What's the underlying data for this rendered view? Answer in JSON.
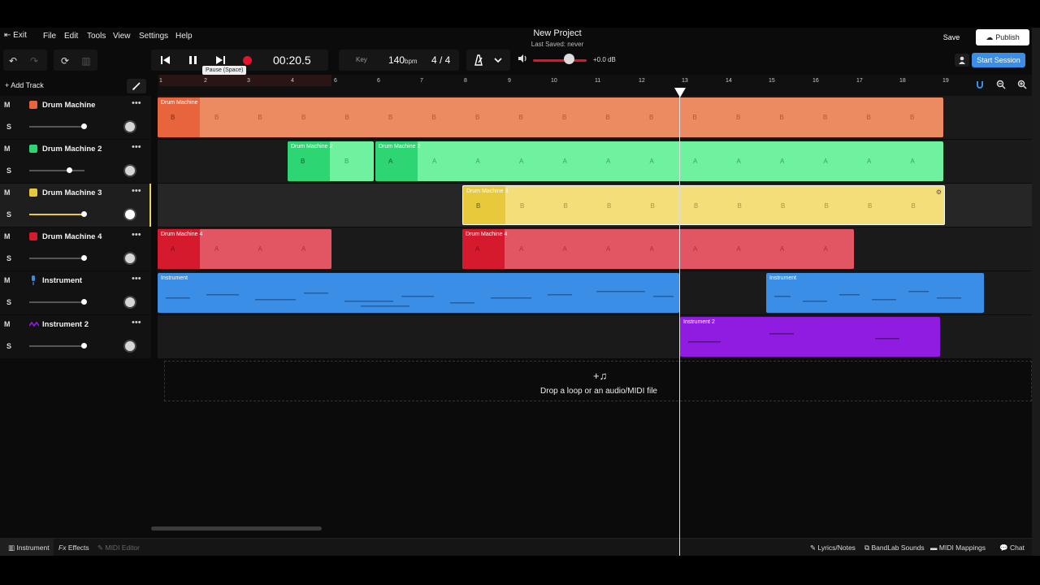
{
  "menu": {
    "exit": "Exit",
    "items": [
      "File",
      "Edit",
      "Tools",
      "View",
      "Settings",
      "Help"
    ]
  },
  "project": {
    "title": "New Project",
    "last_saved": "Last Saved: never"
  },
  "actions": {
    "save": "Save",
    "publish": "Publish",
    "start_session": "Start Session"
  },
  "transport": {
    "time": "00:20.5",
    "tooltip": "Pause (Space)",
    "bpm": "140",
    "bpm_unit": "bpm",
    "key_label": "Key",
    "time_signature": "4 / 4",
    "volume_db": "+0.0 dB",
    "volume_level": 0.66
  },
  "tracks_panel": {
    "add_track": "Add Track"
  },
  "ruler": {
    "marks": [
      "1",
      "2",
      "3",
      "4",
      "6",
      "6",
      "7",
      "8",
      "9",
      "10",
      "11",
      "12",
      "13",
      "14",
      "15",
      "16",
      "17",
      "18",
      "19"
    ]
  },
  "tracks": [
    {
      "name": "Drum Machine",
      "mute": "M",
      "solo": "S",
      "color": "#e8643c",
      "volume": 0.98
    },
    {
      "name": "Drum Machine 2",
      "mute": "M",
      "solo": "S",
      "color": "#2ed573",
      "volume": 0.72
    },
    {
      "name": "Drum Machine 3",
      "mute": "M",
      "solo": "S",
      "color": "#e8c93c",
      "volume": 0.98
    },
    {
      "name": "Drum Machine 4",
      "mute": "M",
      "solo": "S",
      "color": "#d41a2c",
      "volume": 0.98
    },
    {
      "name": "Instrument",
      "mute": "M",
      "solo": "S",
      "color": "#3a8ee6",
      "volume": 0.98
    },
    {
      "name": "Instrument 2",
      "mute": "M",
      "solo": "S",
      "color": "#8f1ce0",
      "volume": 0.98
    }
  ],
  "clips": {
    "drum1": {
      "label": "Drum Machine",
      "pattern": "B"
    },
    "drum2a": {
      "label": "Drum Machine 2",
      "pattern": "B"
    },
    "drum2b": {
      "label": "Drum Machine 2",
      "pattern": "A"
    },
    "drum3": {
      "label": "Drum Machine 3",
      "pattern": "B"
    },
    "drum4a": {
      "label": "Drum Machine 4",
      "pattern": "A"
    },
    "drum4b": {
      "label": "Drum Machine 4",
      "pattern": "A"
    },
    "inst1a": {
      "label": "Instrument"
    },
    "inst1b": {
      "label": "Instrument"
    },
    "inst2": {
      "label": "Instrument 2"
    }
  },
  "drop_zone": {
    "text": "Drop a loop or an audio/MIDI file"
  },
  "bottom_bar": {
    "instrument": "Instrument",
    "effects": "Effects",
    "midi_editor": "MIDI Editor",
    "lyrics": "Lyrics/Notes",
    "sounds": "BandLab Sounds",
    "midi_mappings": "MIDI Mappings",
    "chat": "Chat"
  }
}
